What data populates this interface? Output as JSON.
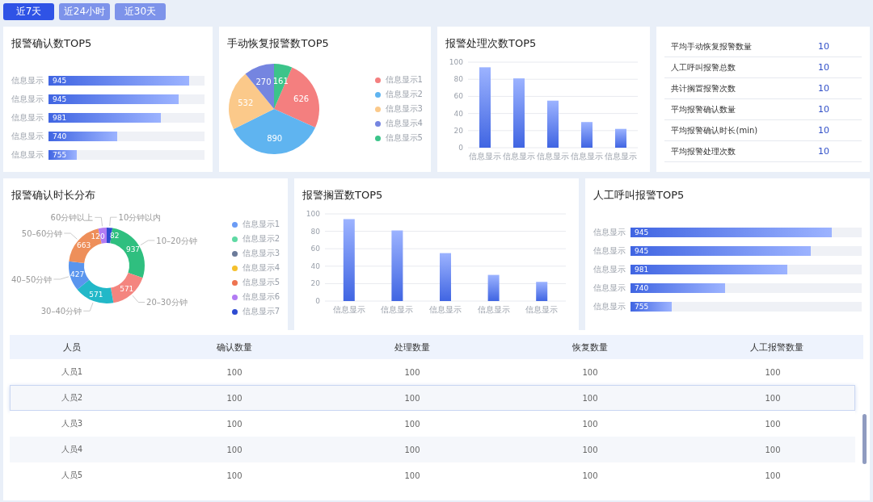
{
  "time_tabs": [
    {
      "label": "近7天",
      "selected": true
    },
    {
      "label": "近24小时",
      "selected": false
    },
    {
      "label": "近30天",
      "selected": false
    }
  ],
  "confirm_top5": {
    "title": "报警确认数TOP5",
    "items": [
      {
        "label": "信息显示",
        "value": "945",
        "level": 0.9
      },
      {
        "label": "信息显示",
        "value": "945",
        "level": 0.83
      },
      {
        "label": "信息显示",
        "value": "981",
        "level": 0.72
      },
      {
        "label": "信息显示",
        "value": "740",
        "level": 0.44
      },
      {
        "label": "信息显示",
        "value": "755",
        "level": 0.18
      }
    ]
  },
  "manual_recovery_top5": {
    "title": "手动恢复报警数TOP5",
    "chart_data": {
      "type": "pie",
      "values": [
        626,
        890,
        532,
        270,
        161
      ],
      "data_labels": true
    },
    "legend": [
      {
        "label": "信息显示1",
        "color": "#f47f7f"
      },
      {
        "label": "信息显示2",
        "color": "#5fb4f0"
      },
      {
        "label": "信息显示3",
        "color": "#fbc98a"
      },
      {
        "label": "信息显示4",
        "color": "#7585e0"
      },
      {
        "label": "信息显示5",
        "color": "#3cc48a"
      }
    ]
  },
  "handling_top5": {
    "title": "报警处理次数TOP5",
    "chart_data": {
      "type": "bar",
      "categories": [
        "信息显示",
        "信息显示",
        "信息显示",
        "信息显示",
        "信息显示"
      ],
      "values": [
        94,
        81,
        55,
        30,
        22
      ],
      "ylim": [
        0,
        100
      ],
      "yticks": [
        0,
        20,
        40,
        60,
        80,
        100
      ],
      "grid": true
    }
  },
  "summary": [
    {
      "label": "平均手动恢复报警数量",
      "value": "10"
    },
    {
      "label": "人工呼叫报警总数",
      "value": "10"
    },
    {
      "label": "共计搁置报警次数",
      "value": "10"
    },
    {
      "label": "平均报警确认数量",
      "value": "10"
    },
    {
      "label": "平均报警确认时长(min)",
      "value": "10"
    },
    {
      "label": "平均报警处理次数",
      "value": "10"
    }
  ],
  "confirm_duration": {
    "title": "报警确认时长分布",
    "chart_data": {
      "type": "donut",
      "categories": [
        "10分钟以内",
        "10–20分钟",
        "20–30分钟",
        "30–40分钟",
        "40–50分钟",
        "50–60分钟",
        "60分钟以上"
      ],
      "values": [
        82,
        937,
        571,
        571,
        427,
        663,
        120
      ],
      "data_labels": true
    },
    "legend": [
      {
        "label": "信息显示1",
        "color": "#6b9bf5"
      },
      {
        "label": "信息显示2",
        "color": "#5fd9a4"
      },
      {
        "label": "信息显示3",
        "color": "#6b7a99"
      },
      {
        "label": "信息显示4",
        "color": "#f5c02c"
      },
      {
        "label": "信息显示5",
        "color": "#ee7350"
      },
      {
        "label": "信息显示6",
        "color": "#b27bf3"
      },
      {
        "label": "信息显示7",
        "color": "#2e4bd1"
      }
    ]
  },
  "shelved_top5": {
    "title": "报警搁置数TOP5",
    "chart_data": {
      "type": "bar",
      "categories": [
        "信息显示",
        "信息显示",
        "信息显示",
        "信息显示",
        "信息显示"
      ],
      "values": [
        94,
        81,
        55,
        30,
        22
      ],
      "ylim": [
        0,
        100
      ],
      "yticks": [
        0,
        20,
        40,
        60,
        80,
        100
      ],
      "grid": true
    }
  },
  "manual_call_top5": {
    "title": "人工呼叫报警TOP5",
    "items": [
      {
        "label": "信息显示",
        "value": "945",
        "level": 0.87
      },
      {
        "label": "信息显示",
        "value": "945",
        "level": 0.78
      },
      {
        "label": "信息显示",
        "value": "981",
        "level": 0.68
      },
      {
        "label": "信息显示",
        "value": "740",
        "level": 0.41
      },
      {
        "label": "信息显示",
        "value": "755",
        "level": 0.18
      }
    ]
  },
  "table": {
    "columns": [
      "人员",
      "确认数量",
      "处理数量",
      "恢复数量",
      "人工报警数量"
    ],
    "rows": [
      {
        "cells": [
          "人员1",
          "100",
          "100",
          "100",
          "100"
        ],
        "selected": false
      },
      {
        "cells": [
          "人员2",
          "100",
          "100",
          "100",
          "100"
        ],
        "selected": true
      },
      {
        "cells": [
          "人员3",
          "100",
          "100",
          "100",
          "100"
        ],
        "selected": false
      },
      {
        "cells": [
          "人员4",
          "100",
          "100",
          "100",
          "100"
        ],
        "selected": false
      },
      {
        "cells": [
          "人员5",
          "100",
          "100",
          "100",
          "100"
        ],
        "selected": false
      }
    ]
  }
}
